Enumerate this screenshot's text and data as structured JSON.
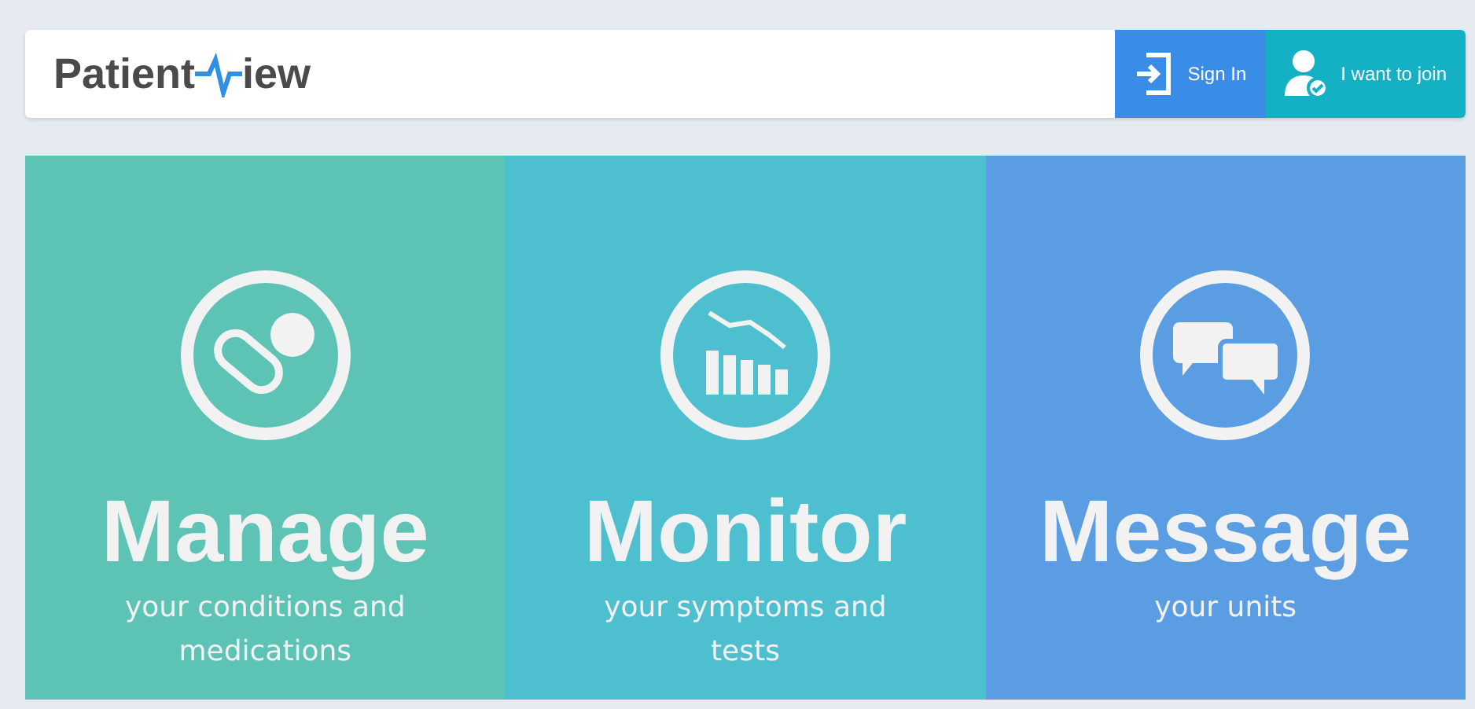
{
  "header": {
    "logo": {
      "before": "Patient",
      "after": "iew"
    },
    "buttons": [
      {
        "kind": "signin",
        "label": "Sign In"
      },
      {
        "kind": "join",
        "label": "I want to join"
      }
    ]
  },
  "panels": [
    {
      "kind": "pills",
      "color": "#5cc3b5",
      "title": "Manage",
      "subtitle": "your conditions and medications"
    },
    {
      "kind": "chart",
      "color": "#4dbfcf",
      "title": "Monitor",
      "subtitle": "your symptoms and tests"
    },
    {
      "kind": "chat",
      "color": "#5b9de2",
      "title": "Message",
      "subtitle": "your units"
    }
  ]
}
